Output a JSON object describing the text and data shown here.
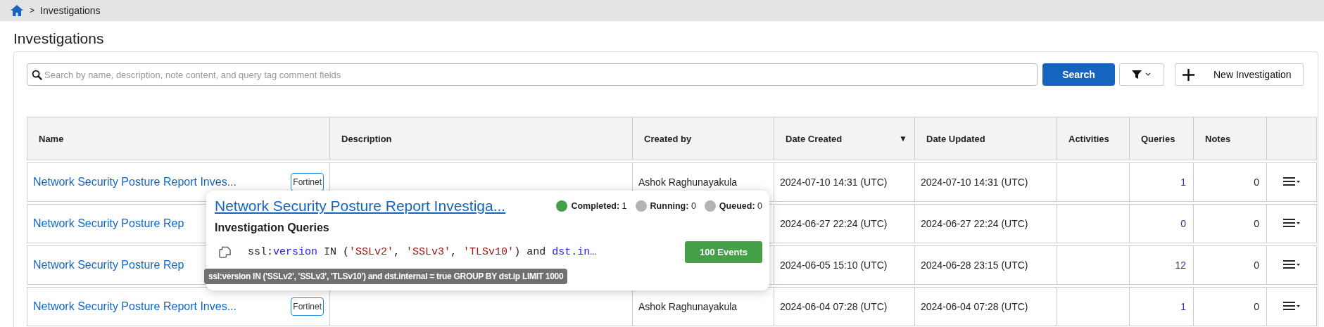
{
  "breadcrumb": {
    "separator": ">",
    "current": "Investigations"
  },
  "page_title": "Investigations",
  "search": {
    "placeholder": "Search by name, description, note content, and query tag comment fields",
    "button": "Search"
  },
  "new_button": "New Investigation",
  "table": {
    "columns": [
      {
        "label": "Name"
      },
      {
        "label": "Description"
      },
      {
        "label": "Created by"
      },
      {
        "label": "Date Created",
        "sort_indicator": "▼"
      },
      {
        "label": "Date Updated"
      },
      {
        "label": "Activities"
      },
      {
        "label": "Queries"
      },
      {
        "label": "Notes"
      },
      {}
    ],
    "rows": [
      {
        "name": "Network Security Posture Report Inves...",
        "tag": "Fortinet",
        "created_by": "Ashok Raghunayakula",
        "date_created": "2024-07-10 14:31 (UTC)",
        "date_updated": "2024-07-10 14:31 (UTC)",
        "queries": "1",
        "notes": "0"
      },
      {
        "name": "Network Security Posture Rep",
        "date_created": "2024-06-27 22:24 (UTC)",
        "date_updated": "2024-06-27 22:24 (UTC)",
        "queries": "0",
        "notes": "0"
      },
      {
        "name": "Network Security Posture Rep",
        "date_created": "2024-06-05 15:10 (UTC)",
        "date_updated": "2024-06-28 23:15 (UTC)",
        "queries": "12",
        "notes": "0"
      },
      {
        "name": "Network Security Posture Report Inves...",
        "tag": "Fortinet",
        "created_by": "Ashok Raghunayakula",
        "date_created": "2024-06-04 07:28 (UTC)",
        "date_updated": "2024-06-04 07:28 (UTC)",
        "queries": "1",
        "notes": "0"
      }
    ]
  },
  "popup": {
    "title": "Network Security Posture Report Investiga...",
    "statuses": [
      {
        "label": "Completed:",
        "count": "1",
        "color": "#43a047"
      },
      {
        "label": "Running:",
        "count": "0",
        "color": "#b3b3b3"
      },
      {
        "label": "Queued:",
        "count": "0",
        "color": "#b3b3b3"
      }
    ],
    "heading": "Investigation Queries",
    "query": [
      {
        "kind": "plain",
        "text": "ssl:"
      },
      {
        "kind": "keyword",
        "text": "version"
      },
      {
        "kind": "plain",
        "text": " IN ("
      },
      {
        "kind": "string",
        "text": "'SSLv2'"
      },
      {
        "kind": "plain",
        "text": ", "
      },
      {
        "kind": "string",
        "text": "'SSLv3'"
      },
      {
        "kind": "plain",
        "text": ", "
      },
      {
        "kind": "string",
        "text": "'TLSv10'"
      },
      {
        "kind": "plain",
        "text": ") and "
      },
      {
        "kind": "keyword",
        "text": "dst.in…"
      }
    ],
    "events_button": "100 Events",
    "tooltip": "ssl:version IN ('SSLv2', 'SSLv3', 'TLSv10') and dst.internal = true GROUP BY dst.ip LIMIT 1000"
  }
}
